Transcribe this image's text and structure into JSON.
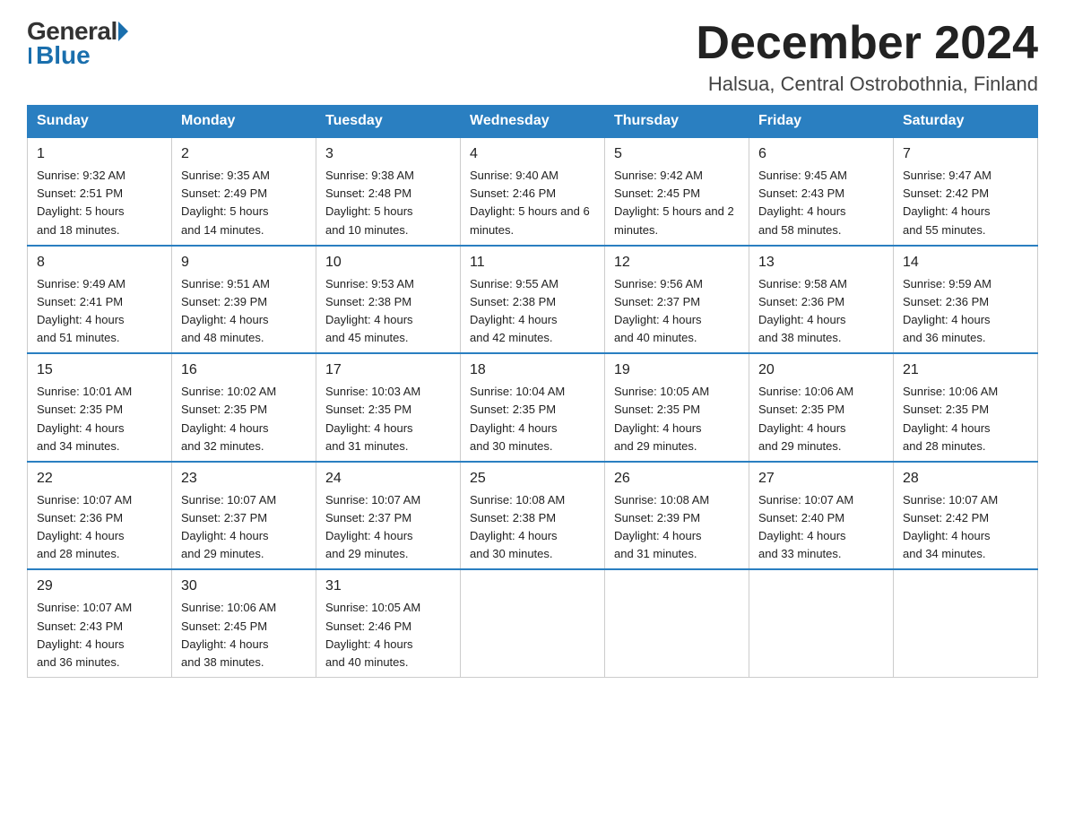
{
  "header": {
    "logo_general": "General",
    "logo_blue": "Blue",
    "month_title": "December 2024",
    "location": "Halsua, Central Ostrobothnia, Finland"
  },
  "days_of_week": [
    "Sunday",
    "Monday",
    "Tuesday",
    "Wednesday",
    "Thursday",
    "Friday",
    "Saturday"
  ],
  "weeks": [
    [
      {
        "num": "1",
        "sunrise": "9:32 AM",
        "sunset": "2:51 PM",
        "daylight": "5 hours and 18 minutes."
      },
      {
        "num": "2",
        "sunrise": "9:35 AM",
        "sunset": "2:49 PM",
        "daylight": "5 hours and 14 minutes."
      },
      {
        "num": "3",
        "sunrise": "9:38 AM",
        "sunset": "2:48 PM",
        "daylight": "5 hours and 10 minutes."
      },
      {
        "num": "4",
        "sunrise": "9:40 AM",
        "sunset": "2:46 PM",
        "daylight": "5 hours and 6 minutes."
      },
      {
        "num": "5",
        "sunrise": "9:42 AM",
        "sunset": "2:45 PM",
        "daylight": "5 hours and 2 minutes."
      },
      {
        "num": "6",
        "sunrise": "9:45 AM",
        "sunset": "2:43 PM",
        "daylight": "4 hours and 58 minutes."
      },
      {
        "num": "7",
        "sunrise": "9:47 AM",
        "sunset": "2:42 PM",
        "daylight": "4 hours and 55 minutes."
      }
    ],
    [
      {
        "num": "8",
        "sunrise": "9:49 AM",
        "sunset": "2:41 PM",
        "daylight": "4 hours and 51 minutes."
      },
      {
        "num": "9",
        "sunrise": "9:51 AM",
        "sunset": "2:39 PM",
        "daylight": "4 hours and 48 minutes."
      },
      {
        "num": "10",
        "sunrise": "9:53 AM",
        "sunset": "2:38 PM",
        "daylight": "4 hours and 45 minutes."
      },
      {
        "num": "11",
        "sunrise": "9:55 AM",
        "sunset": "2:38 PM",
        "daylight": "4 hours and 42 minutes."
      },
      {
        "num": "12",
        "sunrise": "9:56 AM",
        "sunset": "2:37 PM",
        "daylight": "4 hours and 40 minutes."
      },
      {
        "num": "13",
        "sunrise": "9:58 AM",
        "sunset": "2:36 PM",
        "daylight": "4 hours and 38 minutes."
      },
      {
        "num": "14",
        "sunrise": "9:59 AM",
        "sunset": "2:36 PM",
        "daylight": "4 hours and 36 minutes."
      }
    ],
    [
      {
        "num": "15",
        "sunrise": "10:01 AM",
        "sunset": "2:35 PM",
        "daylight": "4 hours and 34 minutes."
      },
      {
        "num": "16",
        "sunrise": "10:02 AM",
        "sunset": "2:35 PM",
        "daylight": "4 hours and 32 minutes."
      },
      {
        "num": "17",
        "sunrise": "10:03 AM",
        "sunset": "2:35 PM",
        "daylight": "4 hours and 31 minutes."
      },
      {
        "num": "18",
        "sunrise": "10:04 AM",
        "sunset": "2:35 PM",
        "daylight": "4 hours and 30 minutes."
      },
      {
        "num": "19",
        "sunrise": "10:05 AM",
        "sunset": "2:35 PM",
        "daylight": "4 hours and 29 minutes."
      },
      {
        "num": "20",
        "sunrise": "10:06 AM",
        "sunset": "2:35 PM",
        "daylight": "4 hours and 29 minutes."
      },
      {
        "num": "21",
        "sunrise": "10:06 AM",
        "sunset": "2:35 PM",
        "daylight": "4 hours and 28 minutes."
      }
    ],
    [
      {
        "num": "22",
        "sunrise": "10:07 AM",
        "sunset": "2:36 PM",
        "daylight": "4 hours and 28 minutes."
      },
      {
        "num": "23",
        "sunrise": "10:07 AM",
        "sunset": "2:37 PM",
        "daylight": "4 hours and 29 minutes."
      },
      {
        "num": "24",
        "sunrise": "10:07 AM",
        "sunset": "2:37 PM",
        "daylight": "4 hours and 29 minutes."
      },
      {
        "num": "25",
        "sunrise": "10:08 AM",
        "sunset": "2:38 PM",
        "daylight": "4 hours and 30 minutes."
      },
      {
        "num": "26",
        "sunrise": "10:08 AM",
        "sunset": "2:39 PM",
        "daylight": "4 hours and 31 minutes."
      },
      {
        "num": "27",
        "sunrise": "10:07 AM",
        "sunset": "2:40 PM",
        "daylight": "4 hours and 33 minutes."
      },
      {
        "num": "28",
        "sunrise": "10:07 AM",
        "sunset": "2:42 PM",
        "daylight": "4 hours and 34 minutes."
      }
    ],
    [
      {
        "num": "29",
        "sunrise": "10:07 AM",
        "sunset": "2:43 PM",
        "daylight": "4 hours and 36 minutes."
      },
      {
        "num": "30",
        "sunrise": "10:06 AM",
        "sunset": "2:45 PM",
        "daylight": "4 hours and 38 minutes."
      },
      {
        "num": "31",
        "sunrise": "10:05 AM",
        "sunset": "2:46 PM",
        "daylight": "4 hours and 40 minutes."
      },
      null,
      null,
      null,
      null
    ]
  ],
  "labels": {
    "sunrise": "Sunrise:",
    "sunset": "Sunset:",
    "daylight": "Daylight:"
  }
}
